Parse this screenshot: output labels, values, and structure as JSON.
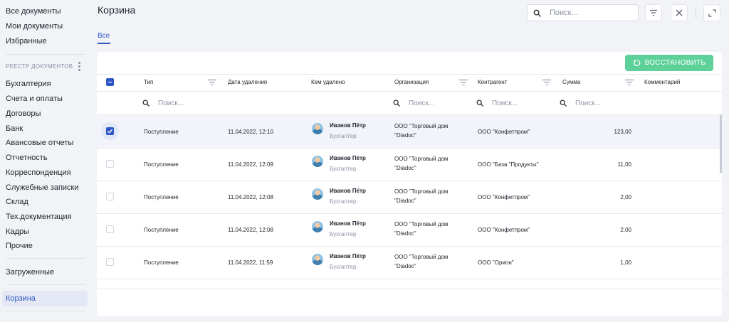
{
  "sidebar": {
    "top_items": [
      {
        "label": "Все документы"
      },
      {
        "label": "Мои документы"
      },
      {
        "label": "Избранные"
      }
    ],
    "section_title": "РЕЕСТР ДОКУМЕНТОВ",
    "registry_items": [
      {
        "label": "Бухгалтерия"
      },
      {
        "label": "Счета и оплаты"
      },
      {
        "label": "Договоры"
      },
      {
        "label": "Банк"
      },
      {
        "label": "Авансовые отчеты"
      },
      {
        "label": "Отчетность"
      },
      {
        "label": "Корреспонденция"
      },
      {
        "label": "Служебные записки"
      },
      {
        "label": "Склад"
      },
      {
        "label": "Тех.документация"
      },
      {
        "label": "Кадры"
      },
      {
        "label": "Прочие"
      }
    ],
    "uploaded": "Загруженные",
    "trash": "Корзина"
  },
  "header": {
    "title": "Корзина",
    "search_placeholder": "Поиск..."
  },
  "tabs": [
    {
      "label": "Все",
      "active": true
    }
  ],
  "toolbar": {
    "restore_label": "ВОССТАНОВИТЬ"
  },
  "table": {
    "columns": {
      "type": "Тип",
      "deleted_at": "Дата удаления",
      "deleted_by": "Кем удалено",
      "organization": "Организация",
      "counterparty": "Контрагент",
      "amount": "Сумма",
      "comment": "Комментарий"
    },
    "column_search_placeholder": "Поиск...",
    "rows": [
      {
        "selected": true,
        "type": "Поступление",
        "deleted_at": "11.04.2022, 12:10",
        "user_name": "Иванов Пётр",
        "user_role": "Бухгалтер",
        "org_line1": "ООО \"Торговый дом",
        "org_line2": "\"Diadoc\"",
        "counterparty": "ООО \"Конфетпром\"",
        "amount": "123,00"
      },
      {
        "selected": false,
        "type": "Поступление",
        "deleted_at": "11.04.2022, 12:09",
        "user_name": "Иванов Пётр",
        "user_role": "Бухгалтер",
        "org_line1": "ООО \"Торговый дом",
        "org_line2": "\"Diadoc\"",
        "counterparty": "ООО \"База \"Продукты\"",
        "amount": "11,00"
      },
      {
        "selected": false,
        "type": "Поступление",
        "deleted_at": "11.04.2022, 12:08",
        "user_name": "Иванов Пётр",
        "user_role": "Бухгалтер",
        "org_line1": "ООО \"Торговый дом",
        "org_line2": "\"Diadoc\"",
        "counterparty": "ООО \"Конфетпром\"",
        "amount": "2,00"
      },
      {
        "selected": false,
        "type": "Поступление",
        "deleted_at": "11.04.2022, 12:08",
        "user_name": "Иванов Пётр",
        "user_role": "Бухгалтер",
        "org_line1": "ООО \"Торговый дом",
        "org_line2": "\"Diadoc\"",
        "counterparty": "ООО \"Конфетпром\"",
        "amount": "2,00"
      },
      {
        "selected": false,
        "type": "Поступление",
        "deleted_at": "11.04.2022, 11:59",
        "user_name": "Иванов Пётр",
        "user_role": "Бухгалтер",
        "org_line1": "ООО \"Торговый дом",
        "org_line2": "\"Diadoc\"",
        "counterparty": "ООО \"Орион\"",
        "amount": "1,00"
      }
    ]
  },
  "colors": {
    "accent": "#2f56c6",
    "restore_button": "#5ed19a",
    "background": "#f2f3f7"
  },
  "icons": {
    "search": "search-icon",
    "filter": "filter-icon",
    "close": "close-icon",
    "expand": "expand-icon",
    "restore": "restore-icon",
    "more": "kebab-icon"
  }
}
